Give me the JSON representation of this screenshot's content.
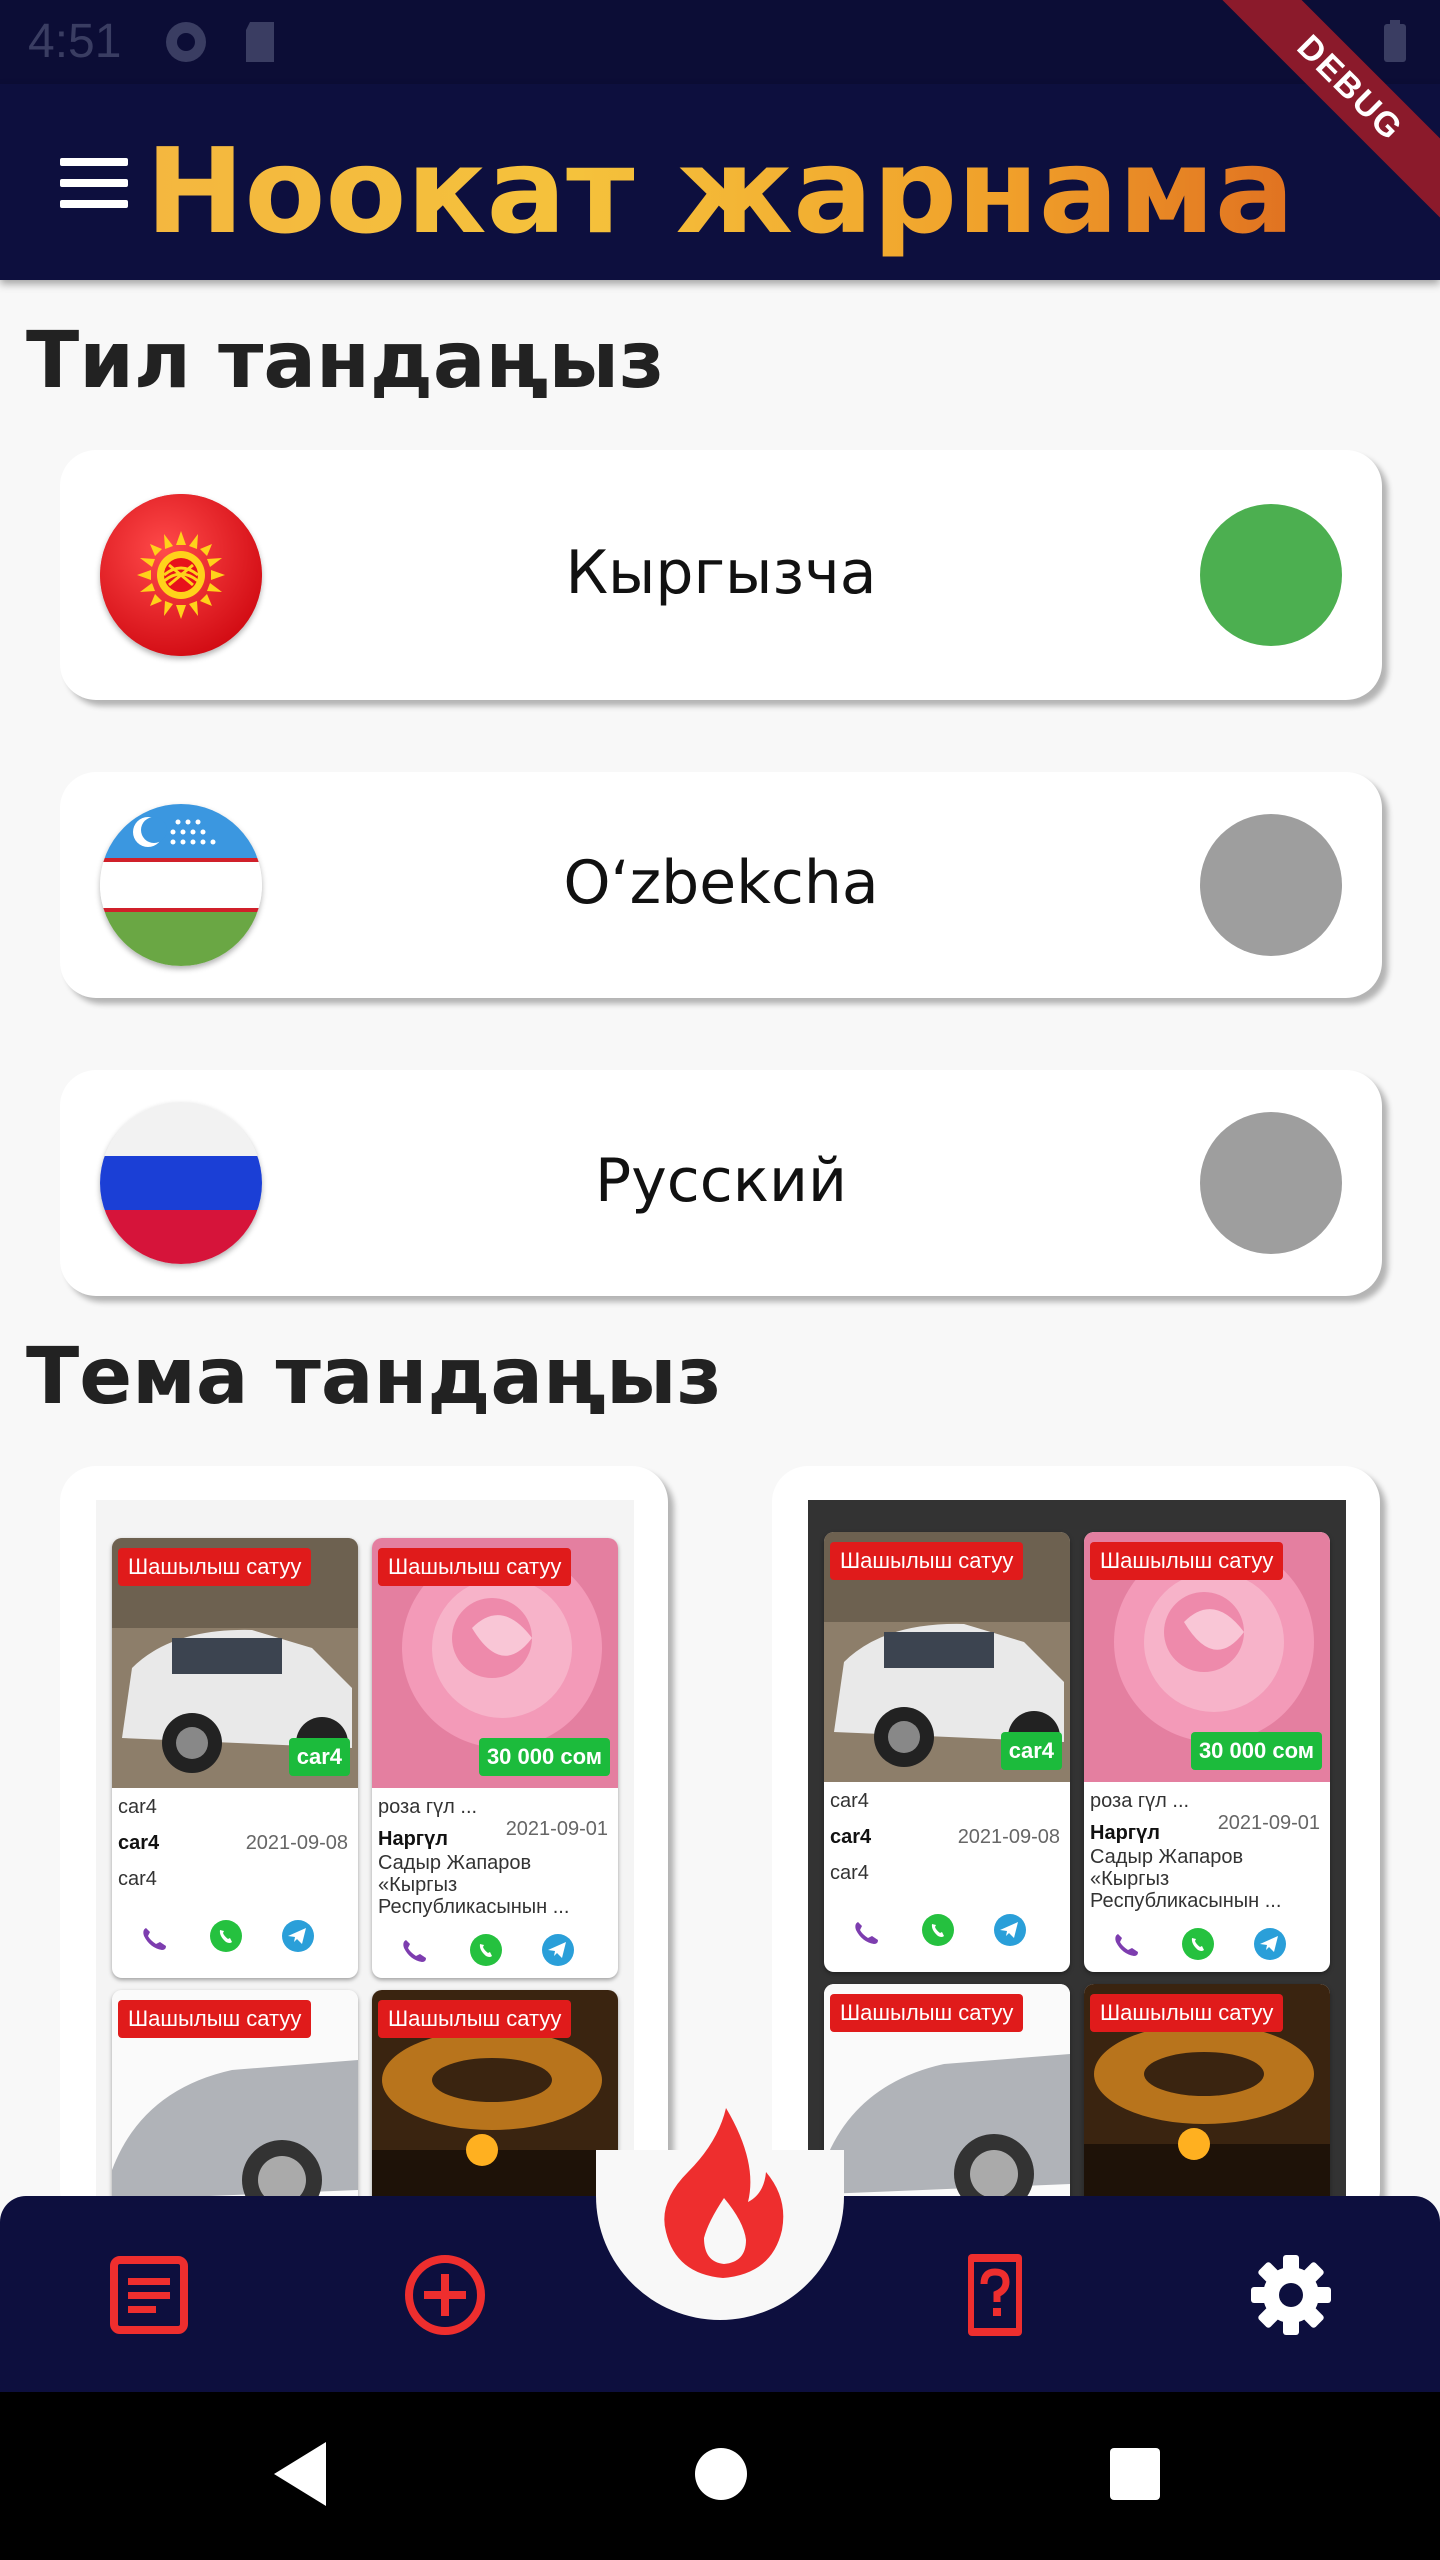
{
  "status_bar": {
    "time": "4:51",
    "debug_label": "DEBUG"
  },
  "app_bar": {
    "title": "Ноокат жарнама",
    "menu_icon": "hamburger-icon"
  },
  "language_section": {
    "title": "Тил тандаңыз",
    "options": [
      {
        "label": "Кыргызча",
        "flag": "kyrgyzstan-flag",
        "selected": true
      },
      {
        "label": "Oʻzbekcha",
        "flag": "uzbekistan-flag",
        "selected": false
      },
      {
        "label": "Русский",
        "flag": "russia-flag",
        "selected": false
      }
    ],
    "selected_color": "#4caf50",
    "unselected_color": "#9e9e9e"
  },
  "theme_section": {
    "title": "Тема тандаңыз",
    "themes": [
      {
        "name": "light",
        "background": "#ffffff"
      },
      {
        "name": "dark",
        "background": "#333333"
      }
    ],
    "preview_items": [
      {
        "badge": "Шашылыш сатуу",
        "price": "car4",
        "title": "car4",
        "author": "car4",
        "date": "2021-09-08",
        "desc": "car4",
        "image": "white-suv"
      },
      {
        "badge": "Шашылыш сатуу",
        "price": "30 000 сом",
        "title": "роза гүл ...",
        "author": "Наргүл",
        "date": "2021-09-01",
        "desc": "Садыр Жапаров «Кыргыз Республикасынын ...",
        "image": "pink-rose"
      },
      {
        "badge": "Шашылыш сатуу",
        "image": "silver-car"
      },
      {
        "badge": "Шашылыш сатуу",
        "image": "sunset"
      }
    ]
  },
  "bottom_nav": {
    "items": [
      "list-icon",
      "add-circle-icon",
      "fire-icon",
      "help-icon",
      "gear-icon"
    ],
    "accent": "#ee2e2e"
  },
  "system_nav": [
    "back-icon",
    "home-icon",
    "recents-icon"
  ]
}
